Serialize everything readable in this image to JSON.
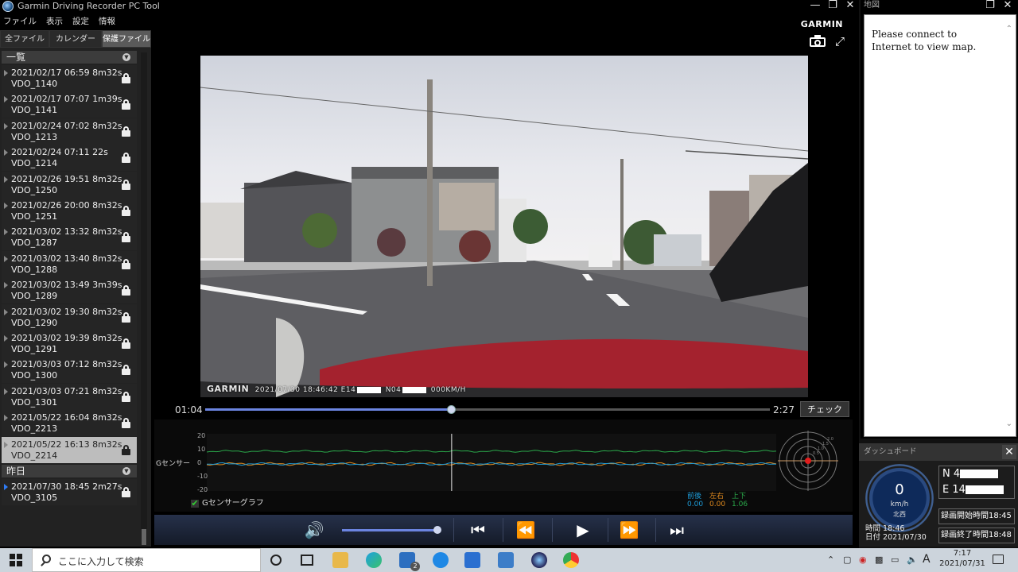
{
  "app": {
    "title": "Garmin Driving Recorder PC Tool",
    "brand": "GARMIN",
    "menu": [
      "ファイル",
      "表示",
      "設定",
      "情報"
    ]
  },
  "left_panel": {
    "tabs": [
      "全ファイル",
      "カレンダー",
      "保護ファイル"
    ],
    "active_tab": 2,
    "groups": [
      {
        "label": "一覧",
        "items": [
          {
            "line1": "2021/02/17 06:59 8m32s",
            "line2": "VDO_1140"
          },
          {
            "line1": "2021/02/17 07:07 1m39s",
            "line2": "VDO_1141"
          },
          {
            "line1": "2021/02/24 07:02 8m32s",
            "line2": "VDO_1213"
          },
          {
            "line1": "2021/02/24 07:11 22s",
            "line2": "VDO_1214"
          },
          {
            "line1": "2021/02/26 19:51 8m32s",
            "line2": "VDO_1250"
          },
          {
            "line1": "2021/02/26 20:00 8m32s",
            "line2": "VDO_1251"
          },
          {
            "line1": "2021/03/02 13:32 8m32s",
            "line2": "VDO_1287"
          },
          {
            "line1": "2021/03/02 13:40 8m32s",
            "line2": "VDO_1288"
          },
          {
            "line1": "2021/03/02 13:49 3m39s",
            "line2": "VDO_1289"
          },
          {
            "line1": "2021/03/02 19:30 8m32s",
            "line2": "VDO_1290"
          },
          {
            "line1": "2021/03/02 19:39 8m32s",
            "line2": "VDO_1291"
          },
          {
            "line1": "2021/03/03 07:12 8m32s",
            "line2": "VDO_1300"
          },
          {
            "line1": "2021/03/03 07:21 8m32s",
            "line2": "VDO_1301"
          },
          {
            "line1": "2021/05/22 16:04 8m32s",
            "line2": "VDO_2213"
          },
          {
            "line1": "2021/05/22 16:13 8m32s",
            "line2": "VDO_2214",
            "selected": true
          }
        ]
      },
      {
        "label": "昨日",
        "items": [
          {
            "line1": "2021/07/30 18:45 2m27s",
            "line2": "VDO_3105",
            "current": true
          }
        ]
      }
    ]
  },
  "video": {
    "overlay_brand": "GARMIN",
    "overlay_datetime": "2021/07/30 18:46:42",
    "overlay_e": "E14",
    "overlay_n": "N04",
    "overlay_speed": "000KM/H"
  },
  "playback": {
    "current_time": "01:04",
    "total_time": "2:27",
    "progress": 0.435,
    "check_label": "チェック",
    "volume": 1.0
  },
  "gsensor": {
    "label": "Gセンサー",
    "y_ticks": [
      "20",
      "10",
      "0",
      "-10",
      "-20"
    ],
    "checkbox_label": "Gセンサーグラフ",
    "checked": true,
    "cursor_fraction": 0.43,
    "axes": [
      {
        "name": "前後",
        "value": "0.00",
        "color": "#1e9bd7"
      },
      {
        "name": "左右",
        "value": "0.00",
        "color": "#e08a1e"
      },
      {
        "name": "上下",
        "value": "1.06",
        "color": "#2aa84a"
      }
    ],
    "radar_labels": [
      "2.0",
      "1.5",
      "1.0",
      "0.5"
    ]
  },
  "map": {
    "title": "地図",
    "message": "Please connect to Internet to view map."
  },
  "dashboard": {
    "title": "ダッシュボード",
    "speed": "0",
    "unit": "km/h",
    "direction": "北西",
    "time_label": "時間",
    "time_value": "18:46",
    "date_label": "日付",
    "date_value": "2021/07/30",
    "lat_prefix": "N 4",
    "lon_prefix": "E 14",
    "rec_start": "録画開始時間18:45",
    "rec_end": "録画終了時間18:48"
  },
  "taskbar": {
    "search_placeholder": "ここに入力して検索",
    "mail_badge": "2",
    "ime": "A",
    "clock_time": "7:17",
    "clock_date": "2021/07/31"
  }
}
